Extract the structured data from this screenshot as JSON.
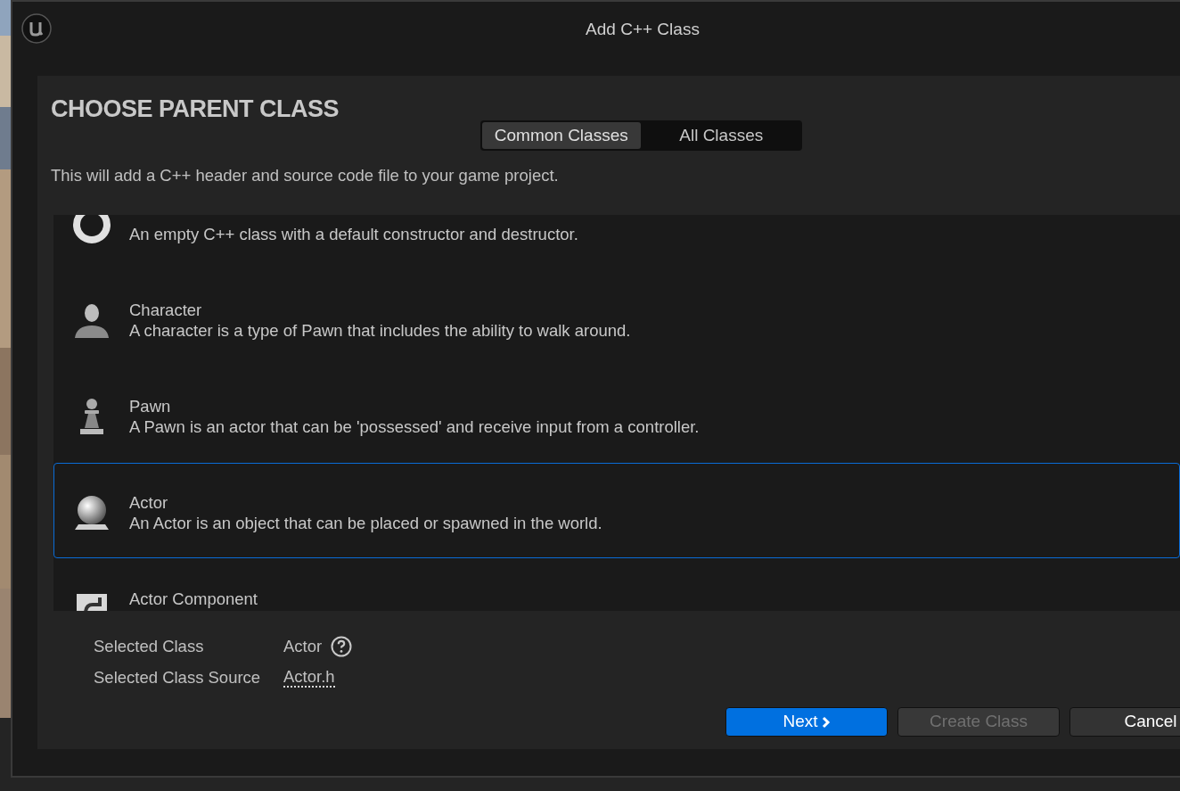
{
  "window": {
    "title": "Add C++ Class"
  },
  "heading": "CHOOSE PARENT CLASS",
  "tabs": [
    {
      "label": "Common Classes",
      "selected": true
    },
    {
      "label": "All Classes",
      "selected": false
    }
  ],
  "description": "This will add a C++ header and source code file to your game project.",
  "classes": [
    {
      "kind": "ring",
      "description": "An empty C++ class with a default constructor and destructor.",
      "selected": false
    },
    {
      "kind": "figure",
      "name": "Character",
      "description": "A character is a type of Pawn that includes the ability to walk around.",
      "selected": false
    },
    {
      "kind": "pawn",
      "name": "Pawn",
      "description": "A Pawn is an actor that can be 'possessed' and receive input from a controller.",
      "selected": false
    },
    {
      "kind": "sphere",
      "name": "Actor",
      "description": "An Actor is an object that can be placed or spawned in the world.",
      "selected": true
    },
    {
      "kind": "component",
      "name": "Actor Component",
      "selected": false
    }
  ],
  "details": [
    {
      "label": "Selected Class",
      "value": "Actor",
      "kind": "help"
    },
    {
      "label": "Selected Class Source",
      "value": "Actor.h",
      "kind": "link"
    }
  ],
  "buttons": [
    {
      "label": "Next",
      "kind": "primary",
      "disabled": false
    },
    {
      "label": "Create Class",
      "kind": "normal",
      "disabled": true
    },
    {
      "label": "Cancel",
      "kind": "normal",
      "disabled": false
    }
  ]
}
